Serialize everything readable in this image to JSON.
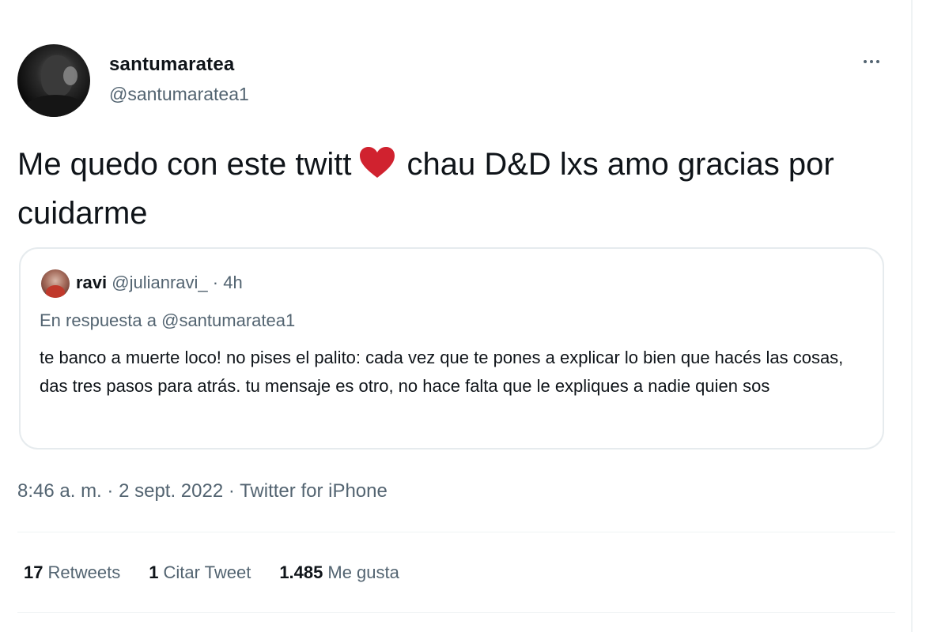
{
  "author": {
    "display_name": "santumaratea",
    "handle": "@santumaratea1",
    "avatar_icon": "profile-photo"
  },
  "tweet": {
    "text_before": "Me quedo con este twitt",
    "emoji": "red-heart-icon",
    "emoji_color": "#d0222f",
    "text_after": "chau D&D lxs amo gracias por cuidarme"
  },
  "quote": {
    "name": "ravi",
    "handle": "@julianravi_",
    "separator": "·",
    "time": "4h",
    "reply_prefix": "En respuesta a",
    "reply_to": "@santumaratea1",
    "text": "te banco a muerte loco! no pises el palito: cada vez que te pones a explicar lo bien que hacés las cosas, das tres pasos para atrás. tu mensaje es otro, no hace falta que le expliques a nadie quien sos"
  },
  "meta": {
    "time": "8:46 a. m.",
    "separator": "·",
    "date": "2 sept. 2022",
    "source": "Twitter for iPhone"
  },
  "stats": {
    "retweets_count": "17",
    "retweets_label": "Retweets",
    "quotes_count": "1",
    "quotes_label": "Citar Tweet",
    "likes_count": "1.485",
    "likes_label": "Me gusta"
  },
  "colors": {
    "text_primary": "#0f1419",
    "text_secondary": "#536471",
    "border": "#e6ebee"
  }
}
